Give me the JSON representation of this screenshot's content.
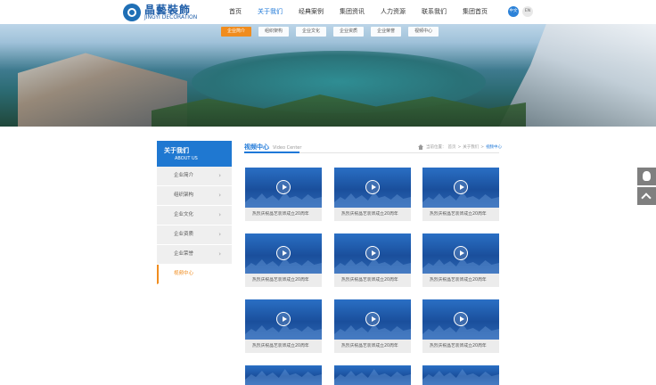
{
  "header": {
    "logo_cn": "晶藝裝飾",
    "logo_en": "JINGYI DECORATION",
    "nav": [
      {
        "label": "首页"
      },
      {
        "label": "关于我们"
      },
      {
        "label": "经典案例"
      },
      {
        "label": "集团资讯"
      },
      {
        "label": "人力资源"
      },
      {
        "label": "联系我们"
      },
      {
        "label": "集团首页"
      }
    ],
    "lang_cn": "中文",
    "lang_en": "EN"
  },
  "banner": {
    "subnav": [
      {
        "label": "企业简介"
      },
      {
        "label": "组织架构"
      },
      {
        "label": "企业文化"
      },
      {
        "label": "企业资质"
      },
      {
        "label": "企业荣誉"
      },
      {
        "label": "视频中心"
      }
    ]
  },
  "sidebar": {
    "title": "关于我们",
    "subtitle": "ABOUT US",
    "items": [
      {
        "label": "企业简介"
      },
      {
        "label": "组织架构"
      },
      {
        "label": "企业文化"
      },
      {
        "label": "企业资质"
      },
      {
        "label": "企业荣誉"
      },
      {
        "label": "视频中心"
      }
    ]
  },
  "main": {
    "title_cn": "视频中心",
    "title_en": "Video Center",
    "breadcrumb": {
      "prefix": "当前位置：",
      "items": [
        "首页",
        "关于我们",
        "视频中心"
      ],
      "sep": ">"
    },
    "videos": [
      {
        "caption": "热烈庆祝晶艺装饰成立20周年"
      },
      {
        "caption": "热烈庆祝晶艺装饰成立20周年"
      },
      {
        "caption": "热烈庆祝晶艺装饰成立20周年"
      },
      {
        "caption": "热烈庆祝晶艺装饰成立20周年"
      },
      {
        "caption": "热烈庆祝晶艺装饰成立20周年"
      },
      {
        "caption": "热烈庆祝晶艺装饰成立20周年"
      },
      {
        "caption": "热烈庆祝晶艺装饰成立20周年"
      },
      {
        "caption": "热烈庆祝晶艺装饰成立20周年"
      },
      {
        "caption": "热烈庆祝晶艺装饰成立20周年"
      },
      {
        "caption": ""
      },
      {
        "caption": ""
      },
      {
        "caption": ""
      }
    ]
  },
  "colors": {
    "brand": "#1e78d8",
    "accent": "#f08c1e",
    "float_bg": "#7f7f7f"
  },
  "icons": {
    "qq": "qq-icon",
    "back_to_top": "arrow-up-icon",
    "play": "play-icon",
    "home": "home-icon",
    "arrow": "chevron-right-icon"
  }
}
